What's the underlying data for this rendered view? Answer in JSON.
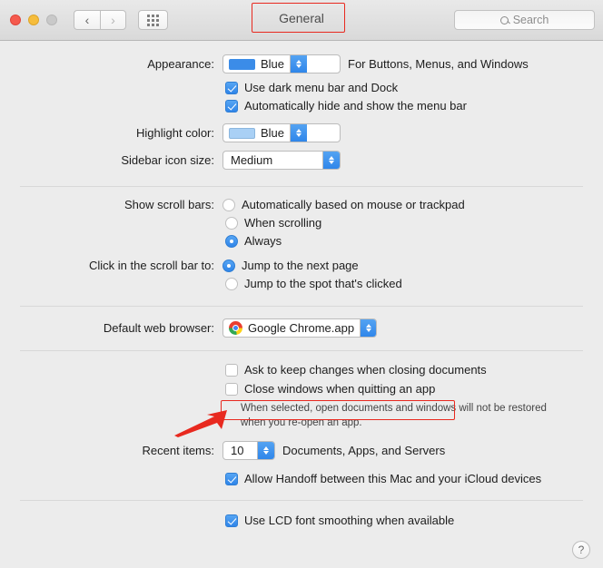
{
  "window": {
    "title": "General",
    "traffic_lights": [
      "close",
      "minimize",
      "zoom"
    ],
    "nav_back": "‹",
    "nav_forward": "›",
    "show_all_icon": "grid-icon",
    "search": {
      "placeholder": "Search",
      "icon": "search-icon"
    },
    "help_label": "?"
  },
  "appearance": {
    "label": "Appearance:",
    "value": "Blue",
    "swatch_color": "#3b8ce8",
    "hint": "For Buttons, Menus, and Windows",
    "checkboxes": [
      {
        "label": "Use dark menu bar and Dock",
        "checked": true
      },
      {
        "label": "Automatically hide and show the menu bar",
        "checked": true
      }
    ]
  },
  "highlight": {
    "label": "Highlight color:",
    "value": "Blue",
    "swatch_color": "#a9d0f5"
  },
  "sidebar_icon": {
    "label": "Sidebar icon size:",
    "value": "Medium"
  },
  "scroll_bars": {
    "label": "Show scroll bars:",
    "options": [
      {
        "label": "Automatically based on mouse or trackpad",
        "selected": false
      },
      {
        "label": "When scrolling",
        "selected": false
      },
      {
        "label": "Always",
        "selected": true
      }
    ]
  },
  "scroll_click": {
    "label": "Click in the scroll bar to:",
    "options": [
      {
        "label": "Jump to the next page",
        "selected": true
      },
      {
        "label": "Jump to the spot that's clicked",
        "selected": false
      }
    ]
  },
  "browser": {
    "label": "Default web browser:",
    "value": "Google Chrome.app",
    "icon": "chrome-icon"
  },
  "documents": {
    "checkboxes": [
      {
        "label": "Ask to keep changes when closing documents",
        "checked": false
      },
      {
        "label": "Close windows when quitting an app",
        "checked": false
      }
    ],
    "description_line1": "When selected, open documents and windows will not be restored",
    "description_line2": "when you re-open an app."
  },
  "recent_items": {
    "label": "Recent items:",
    "value": "10",
    "hint": "Documents, Apps, and Servers"
  },
  "handoff": {
    "label": "Allow Handoff between this Mac and your iCloud devices",
    "checked": true
  },
  "font_smoothing": {
    "label": "Use LCD font smoothing when available",
    "checked": true
  },
  "annotations": {
    "accent_color": "#e8291f",
    "title_highlight": "General",
    "checkbox_highlight": "Close windows when quitting an app",
    "arrow": "red-arrow-pointer"
  }
}
